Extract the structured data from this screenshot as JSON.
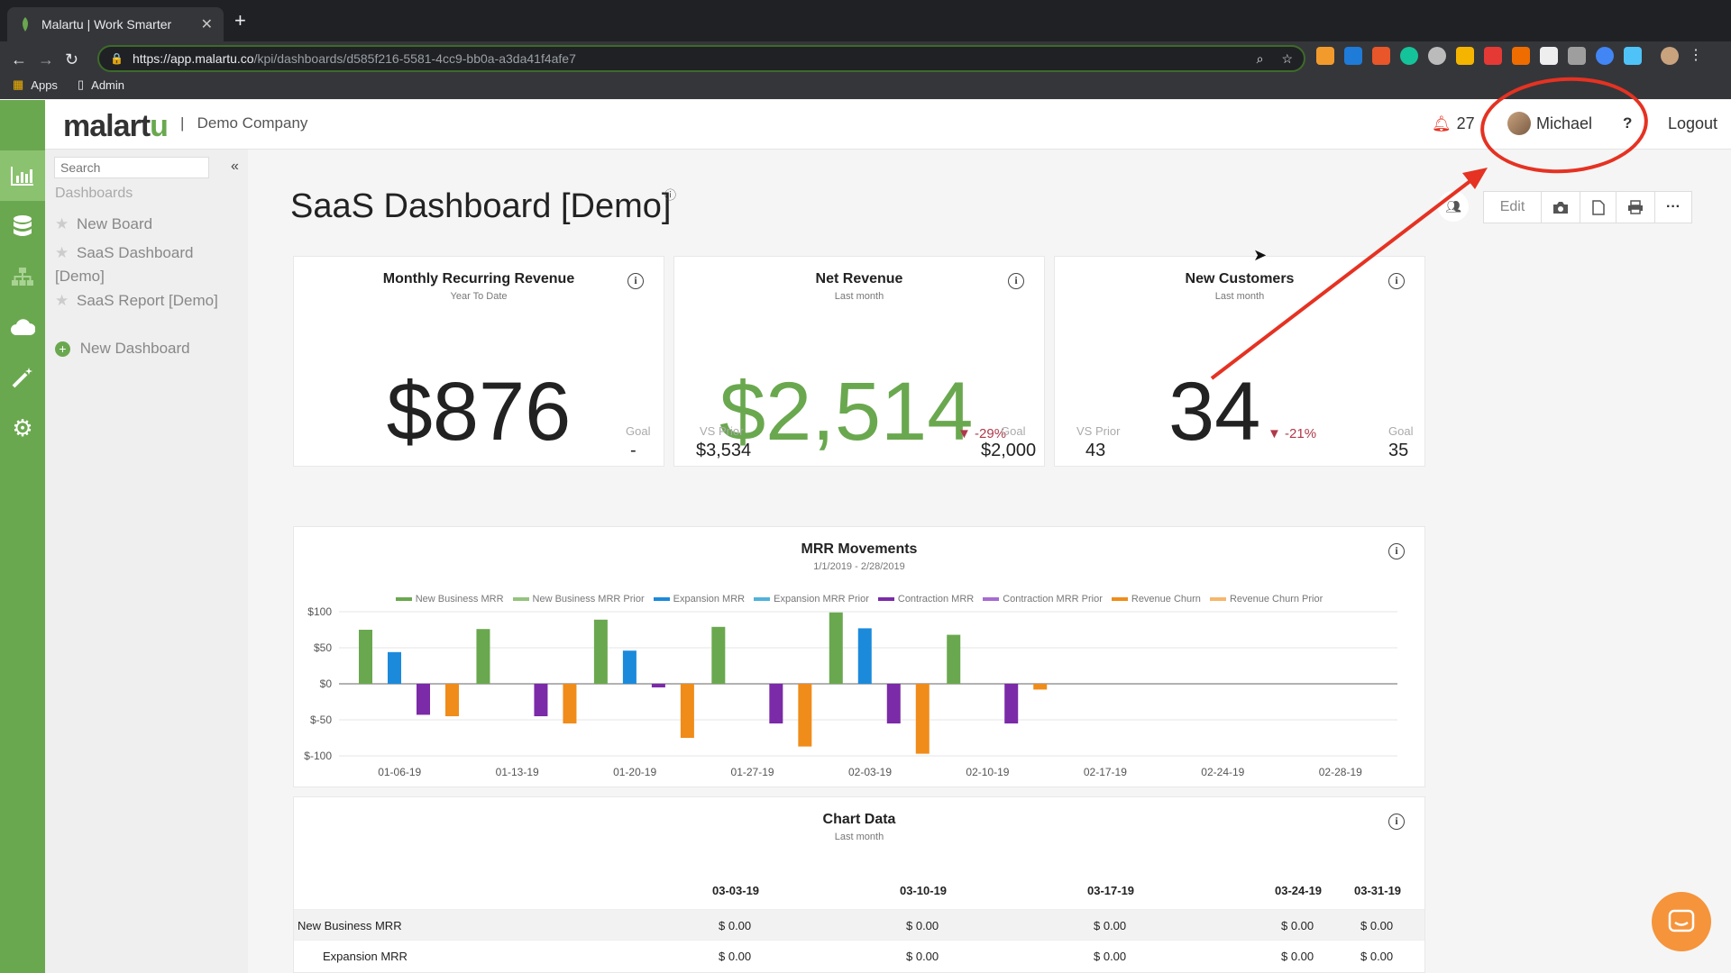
{
  "browser": {
    "tab_title": "Malartu | Work Smarter",
    "url_host": "https://app.malartu.co",
    "url_path": "/kpi/dashboards/d585f216-5581-4cc9-bb0a-a3da41f4afe7",
    "bookmarks": [
      "Apps",
      "Admin"
    ]
  },
  "header": {
    "logo_prefix": "malart",
    "logo_suffix": "u",
    "separator": "|",
    "company": "Demo Company",
    "notification_count": "27",
    "user_name": "Michael",
    "help_label": "?",
    "logout_label": "Logout"
  },
  "sidebar": {
    "search_placeholder": "Search",
    "section": "Dashboards",
    "items": [
      {
        "label": "New Board"
      },
      {
        "label": "SaaS Dashboard [Demo]"
      },
      {
        "label": "SaaS Report [Demo]"
      },
      {
        "label": "New Dashboard"
      }
    ]
  },
  "page": {
    "title": "SaaS Dashboard [Demo]",
    "toolbar": {
      "edit_label": "Edit"
    }
  },
  "kpis": [
    {
      "title": "Monthly Recurring Revenue",
      "subtitle": "Year To Date",
      "value": "$876",
      "goal_label": "Goal",
      "goal_value": "-"
    },
    {
      "title": "Net Revenue",
      "subtitle": "Last month",
      "value": "$2,514",
      "delta": "-29%",
      "prior_label": "VS Prior",
      "prior_value": "$3,534",
      "goal_label": "Goal",
      "goal_value": "$2,000"
    },
    {
      "title": "New Customers",
      "subtitle": "Last month",
      "value": "34",
      "delta": "-21%",
      "prior_label": "VS Prior",
      "prior_value": "43",
      "goal_label": "Goal",
      "goal_value": "35"
    }
  ],
  "chart_data": {
    "type": "bar",
    "title": "MRR Movements",
    "subtitle": "1/1/2019 - 2/28/2019",
    "categories": [
      "01-06-19",
      "01-13-19",
      "01-20-19",
      "01-27-19",
      "02-03-19",
      "02-10-19",
      "02-17-19",
      "02-24-19",
      "02-28-19"
    ],
    "ylim": [
      -100,
      100
    ],
    "yticks": [
      "$100",
      "$50",
      "$0",
      "$-50",
      "$-100"
    ],
    "legend_position": "top",
    "series": [
      {
        "name": "New Business MRR",
        "color": "#6aa84f",
        "values": [
          75,
          76,
          89,
          79,
          99,
          68,
          0,
          0,
          0
        ]
      },
      {
        "name": "New Business MRR Prior",
        "color": "#93c47d",
        "values": [
          0,
          0,
          0,
          0,
          0,
          0,
          0,
          0,
          0
        ]
      },
      {
        "name": "Expansion MRR",
        "color": "#1c8adb",
        "values": [
          44,
          0,
          46,
          0,
          77,
          0,
          0,
          0,
          0
        ]
      },
      {
        "name": "Expansion MRR Prior",
        "color": "#4fb3d9",
        "values": [
          0,
          0,
          0,
          0,
          0,
          0,
          0,
          0,
          0
        ]
      },
      {
        "name": "Contraction MRR",
        "color": "#7b2aa8",
        "values": [
          -43,
          -45,
          -5,
          -55,
          -55,
          -55,
          0,
          0,
          0
        ]
      },
      {
        "name": "Contraction MRR Prior",
        "color": "#a86bd1",
        "values": [
          0,
          0,
          0,
          0,
          0,
          0,
          0,
          0,
          0
        ]
      },
      {
        "name": "Revenue Churn",
        "color": "#f08c1a",
        "values": [
          -45,
          -55,
          -75,
          -87,
          -97,
          -8,
          0,
          0,
          0
        ]
      },
      {
        "name": "Revenue Churn Prior",
        "color": "#f7b66b",
        "values": [
          0,
          0,
          0,
          0,
          0,
          0,
          0,
          0,
          0
        ]
      }
    ]
  },
  "table": {
    "title": "Chart Data",
    "subtitle": "Last month",
    "columns": [
      "03-03-19",
      "03-10-19",
      "03-17-19",
      "03-24-19",
      "03-31-19"
    ],
    "rows": [
      {
        "label": "New Business MRR",
        "values": [
          "$ 0.00",
          "$ 0.00",
          "$ 0.00",
          "$ 0.00",
          "$ 0.00"
        ]
      },
      {
        "label": "Expansion MRR",
        "values": [
          "$ 0.00",
          "$ 0.00",
          "$ 0.00",
          "$ 0.00",
          "$ 0.00"
        ]
      }
    ]
  },
  "colors": {
    "brand_green": "#6aa84f",
    "negative_red": "#b0384a",
    "annotation_red": "#e53222",
    "chat_orange": "#f5943b"
  }
}
